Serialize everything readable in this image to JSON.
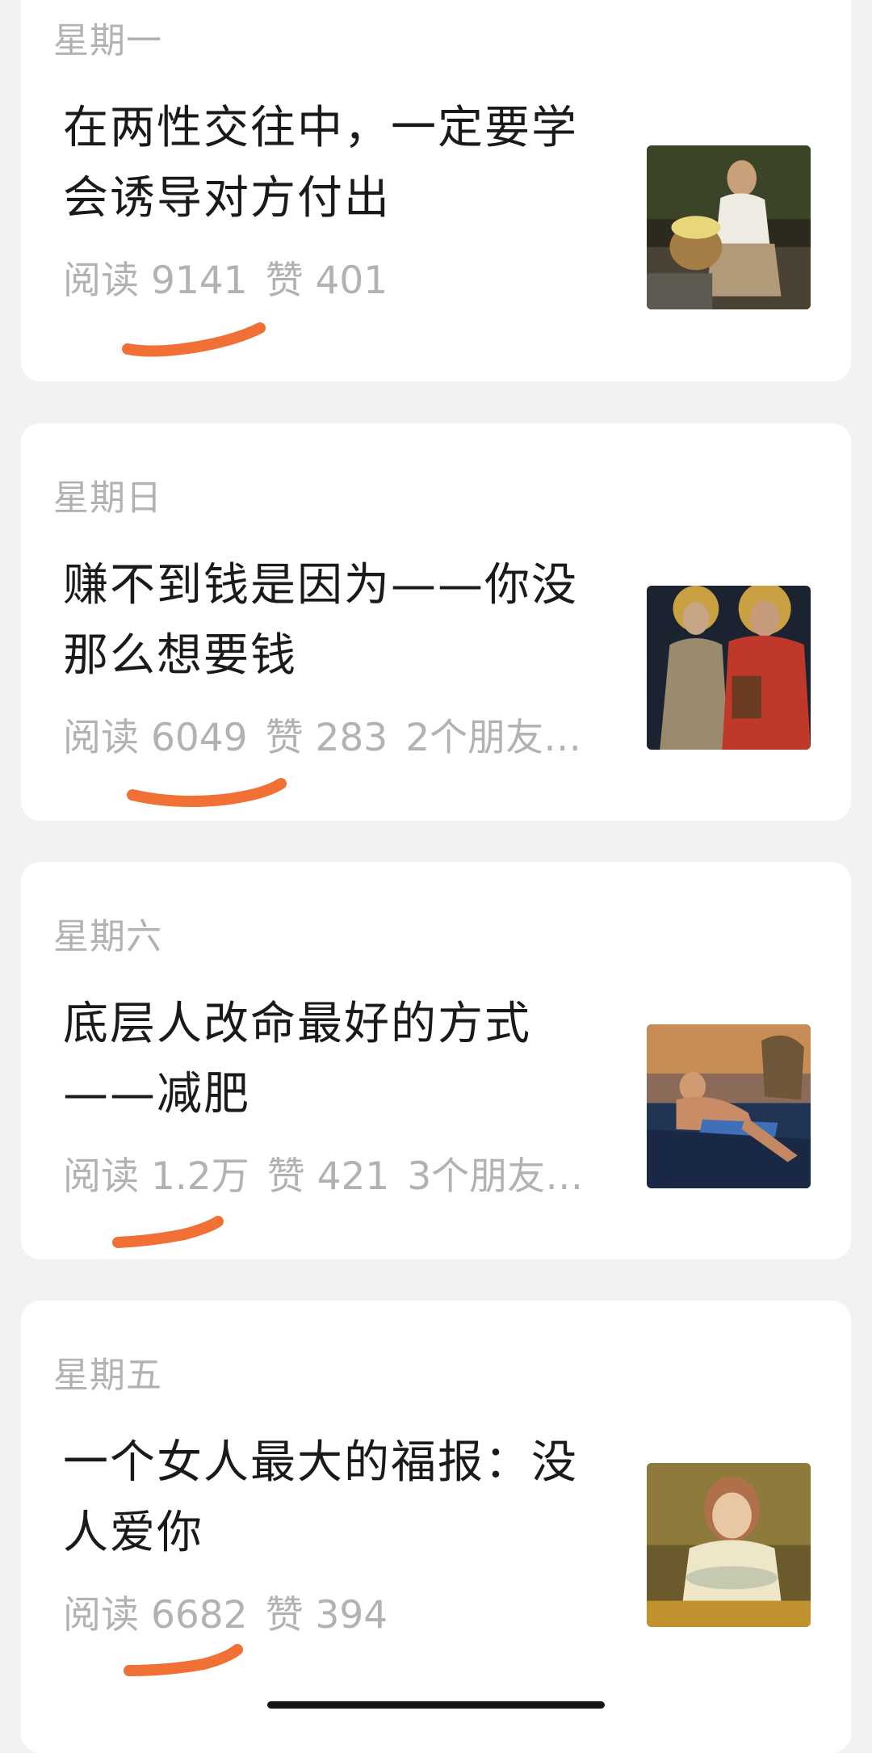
{
  "articles": [
    {
      "weekday": "星期一",
      "title": "在两性交往中，一定要学会诱导对方付出",
      "reads": "阅读 9141",
      "likes": "赞 401",
      "friends": "",
      "thumb": "woman-with-flower-basket-painting"
    },
    {
      "weekday": "星期日",
      "title": "赚不到钱是因为——你没那么想要钱",
      "reads": "阅读 6049",
      "likes": "赞 283",
      "friends": "2个朋友…",
      "thumb": "two-saints-painting"
    },
    {
      "weekday": "星期六",
      "title": "底层人改命最好的方式——减肥",
      "reads": "阅读 1.2万",
      "likes": "赞 421",
      "friends": "3个朋友…",
      "thumb": "reclining-man-with-lion-painting"
    },
    {
      "weekday": "星期五",
      "title": "一个女人最大的福报：没人爱你",
      "reads": "阅读 6682",
      "likes": "赞 394",
      "friends": "",
      "thumb": "girl-with-flowers-painting"
    }
  ],
  "colors": {
    "background": "#f2f2f2",
    "card": "#ffffff",
    "meta_text": "#b2b2b2",
    "title_text": "#1a1a1a",
    "underline_mark": "#f07035"
  }
}
